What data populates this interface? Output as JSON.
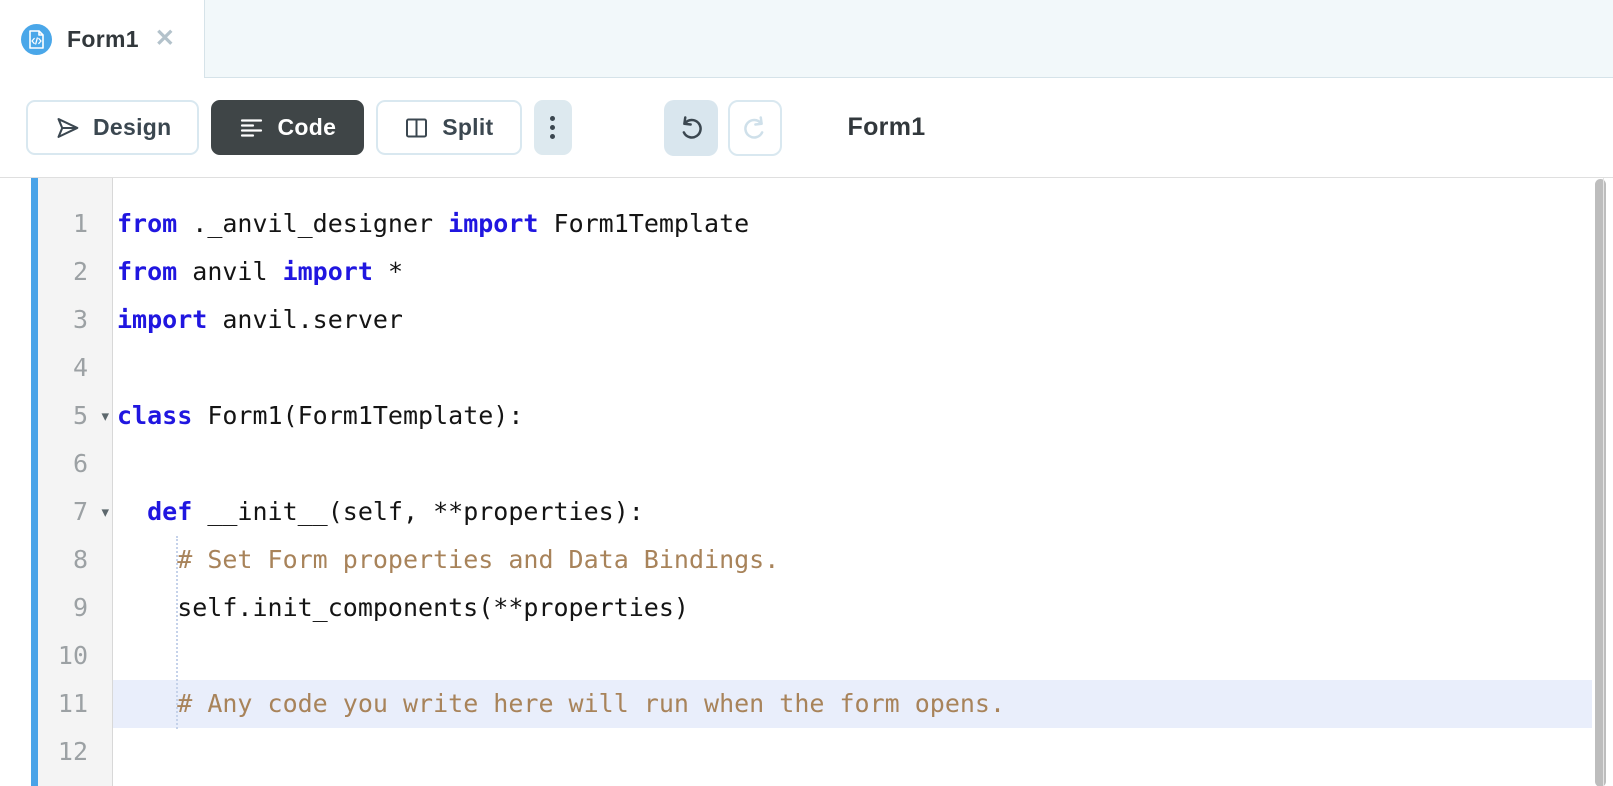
{
  "tab": {
    "label": "Form1",
    "close_glyph": "✕",
    "icon": "form-code-file-icon"
  },
  "toolbar": {
    "design_label": "Design",
    "code_label": "Code",
    "split_label": "Split",
    "title": "Form1",
    "icons": [
      "paper-plane-icon",
      "align-left-icon",
      "split-pane-icon",
      "kebab-menu-icon",
      "undo-icon",
      "redo-icon"
    ]
  },
  "editor": {
    "fold_glyph": "▾",
    "colors": {
      "accent_bar": "#49a3e8",
      "keyword": "#2016e0",
      "comment": "#a8835a",
      "text": "#141414",
      "active_line_highlight": "#e9eefb"
    },
    "lines": [
      {
        "num": 1,
        "fold": false,
        "hl": false,
        "tokens": [
          [
            "kw",
            "from"
          ],
          [
            "t",
            " ._anvil_designer "
          ],
          [
            "kw",
            "import"
          ],
          [
            "t",
            " Form1Template"
          ]
        ]
      },
      {
        "num": 2,
        "fold": false,
        "hl": false,
        "tokens": [
          [
            "kw",
            "from"
          ],
          [
            "t",
            " anvil "
          ],
          [
            "kw",
            "import"
          ],
          [
            "t",
            " *"
          ]
        ]
      },
      {
        "num": 3,
        "fold": false,
        "hl": false,
        "tokens": [
          [
            "kw",
            "import"
          ],
          [
            "t",
            " anvil.server"
          ]
        ]
      },
      {
        "num": 4,
        "fold": false,
        "hl": false,
        "tokens": []
      },
      {
        "num": 5,
        "fold": true,
        "hl": false,
        "tokens": [
          [
            "kw",
            "class"
          ],
          [
            "t",
            " Form1(Form1Template):"
          ]
        ]
      },
      {
        "num": 6,
        "fold": false,
        "hl": false,
        "tokens": []
      },
      {
        "num": 7,
        "fold": true,
        "hl": false,
        "tokens": [
          [
            "t",
            "  "
          ],
          [
            "kw",
            "def"
          ],
          [
            "t",
            " __init__(self, **properties):"
          ]
        ]
      },
      {
        "num": 8,
        "fold": false,
        "hl": false,
        "tokens": [
          [
            "t",
            "    "
          ],
          [
            "c",
            "# Set Form properties and Data Bindings."
          ]
        ]
      },
      {
        "num": 9,
        "fold": false,
        "hl": false,
        "tokens": [
          [
            "t",
            "    self.init_components(**properties)"
          ]
        ]
      },
      {
        "num": 10,
        "fold": false,
        "hl": false,
        "tokens": []
      },
      {
        "num": 11,
        "fold": false,
        "hl": true,
        "tokens": [
          [
            "t",
            "    "
          ],
          [
            "c",
            "# Any code you write here will run when the form opens."
          ]
        ]
      },
      {
        "num": 12,
        "fold": false,
        "hl": false,
        "tokens": []
      }
    ]
  }
}
